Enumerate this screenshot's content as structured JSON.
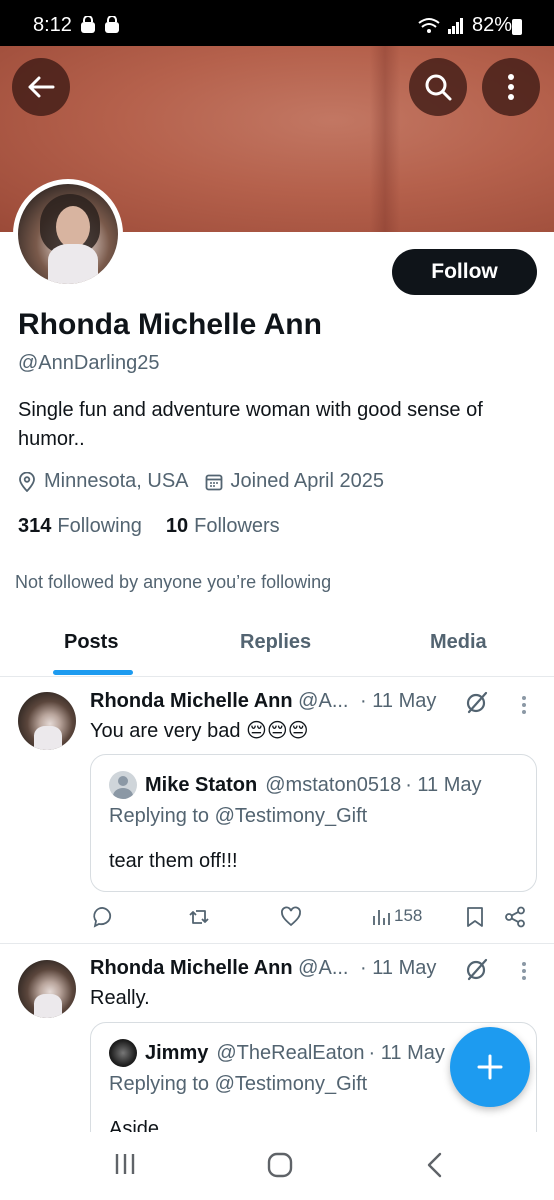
{
  "status_bar": {
    "time": "8:12",
    "battery": "82%"
  },
  "profile": {
    "name": "Rhonda Michelle Ann",
    "handle": "@AnnDarling25",
    "bio": "Single fun and adventure woman with good sense of humor..",
    "location": "Minnesota, USA",
    "joined": "Joined April 2025",
    "following_count": "314",
    "following_label": "Following",
    "followers_count": "10",
    "followers_label": "Followers",
    "not_followed_text": "Not followed by anyone you’re following",
    "follow_label": "Follow"
  },
  "tabs": [
    {
      "label": "Posts",
      "active": true
    },
    {
      "label": "Replies",
      "active": false
    },
    {
      "label": "Media",
      "active": false
    }
  ],
  "posts": [
    {
      "author": "Rhonda Michelle Ann",
      "handle": "@A...",
      "date": "· 11 May",
      "text": "You are very bad 😔😔😔",
      "quote": {
        "author": "Mike Staton",
        "handle": "@mstaton0518",
        "date": "· 11 May",
        "replying": "Replying to @Testimony_Gift",
        "text": "tear them off!!!"
      },
      "views": "158"
    },
    {
      "author": "Rhonda Michelle Ann",
      "handle": "@A...",
      "date": "· 11 May",
      "text": "Really.",
      "quote": {
        "author": "Jimmy",
        "handle": "@TheRealEaton",
        "date": "· 11 May",
        "replying": "Replying to @Testimony_Gift",
        "text": "Aside"
      }
    }
  ],
  "colors": {
    "accent": "#1d9bf0",
    "text": "#0f1419",
    "secondary": "#536471",
    "button": "#0f1419"
  }
}
